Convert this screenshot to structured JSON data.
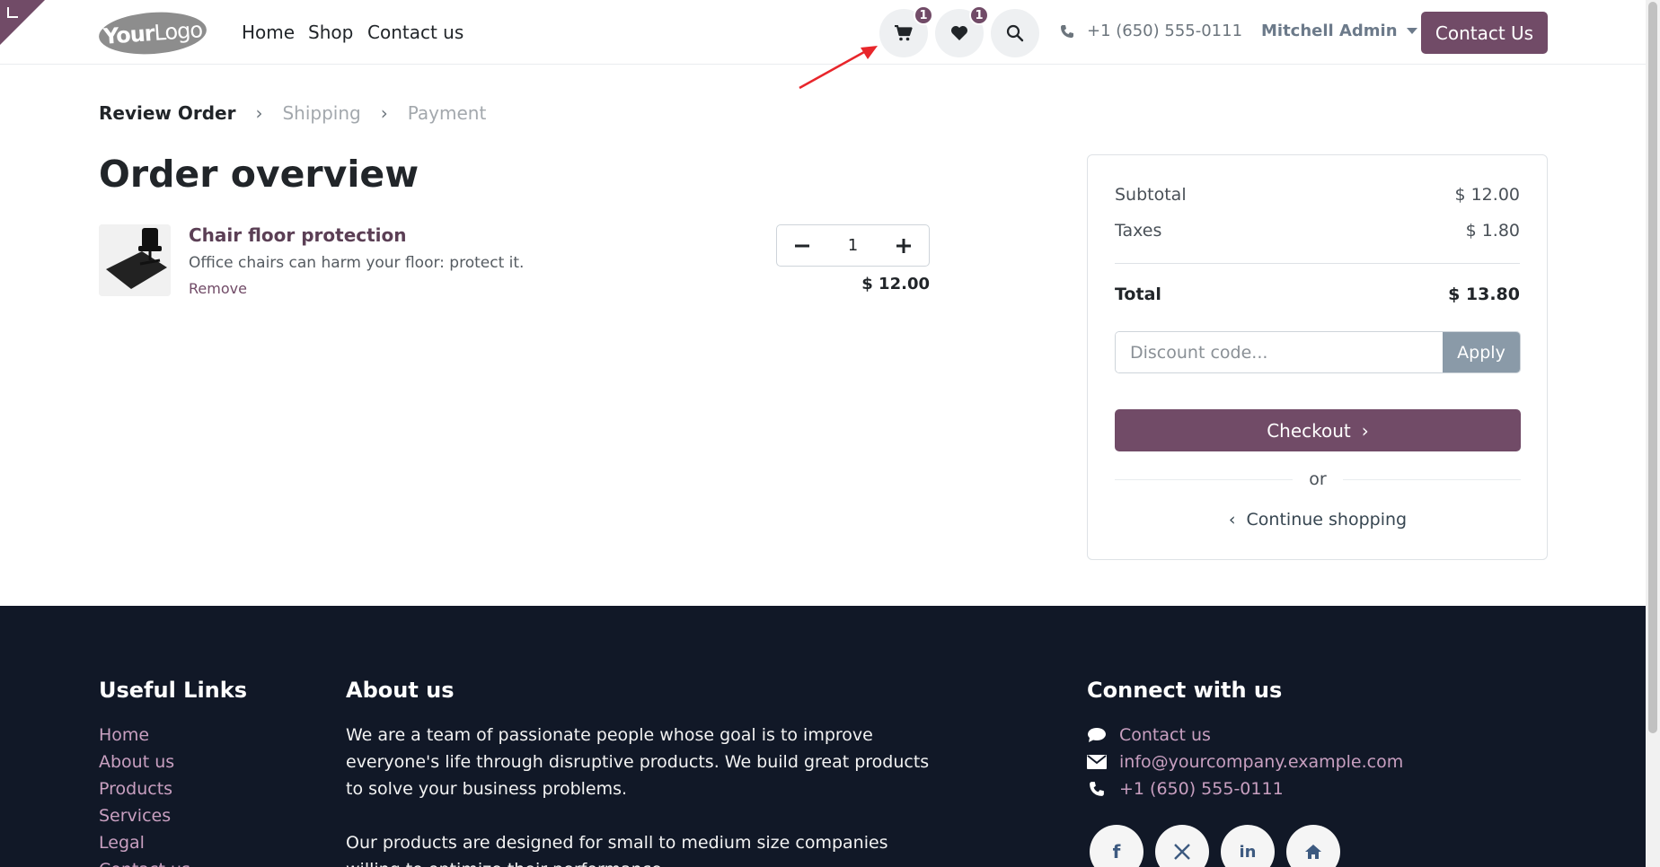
{
  "header": {
    "logo": {
      "bold": "Your",
      "thin": "Logo"
    },
    "nav": [
      "Home",
      "Shop",
      "Contact us"
    ],
    "cart_badge": "1",
    "wishlist_badge": "1",
    "phone": "+1 (650) 555-0111",
    "user": "Mitchell Admin",
    "contact_button": "Contact Us"
  },
  "steps": [
    "Review Order",
    "Shipping",
    "Payment"
  ],
  "page_title": "Order overview",
  "cart": {
    "items": [
      {
        "name": "Chair floor protection",
        "description": "Office chairs can harm your floor: protect it.",
        "remove_label": "Remove",
        "quantity": "1",
        "price": "$ 12.00"
      }
    ]
  },
  "summary": {
    "subtotal_label": "Subtotal",
    "subtotal_value": "$ 12.00",
    "taxes_label": "Taxes",
    "taxes_value": "$ 1.80",
    "total_label": "Total",
    "total_value": "$ 13.80",
    "discount_placeholder": "Discount code...",
    "apply_label": "Apply",
    "checkout_label": "Checkout",
    "or_label": "or",
    "continue_label": "Continue shopping"
  },
  "footer": {
    "useful_links_heading": "Useful Links",
    "useful_links": [
      "Home",
      "About us",
      "Products",
      "Services",
      "Legal",
      "Contact us"
    ],
    "about_heading": "About us",
    "about_text_1": "We are a team of passionate people whose goal is to improve everyone's life through disruptive products. We build great products to solve your business problems.",
    "about_text_2": "Our products are designed for small to medium size companies willing to optimize their performance.",
    "connect_heading": "Connect with us",
    "contact_us": "Contact us",
    "email": "info@yourcompany.example.com",
    "phone": "+1 (650) 555-0111",
    "social_icons": [
      "facebook-icon",
      "x-twitter-icon",
      "linkedin-icon",
      "home-icon"
    ]
  },
  "colors": {
    "brand": "#714B67",
    "footer_bg": "#111827",
    "footer_link": "#c89fc0",
    "apply_button": "#8a9aa8",
    "arrow": "#e8262b"
  }
}
